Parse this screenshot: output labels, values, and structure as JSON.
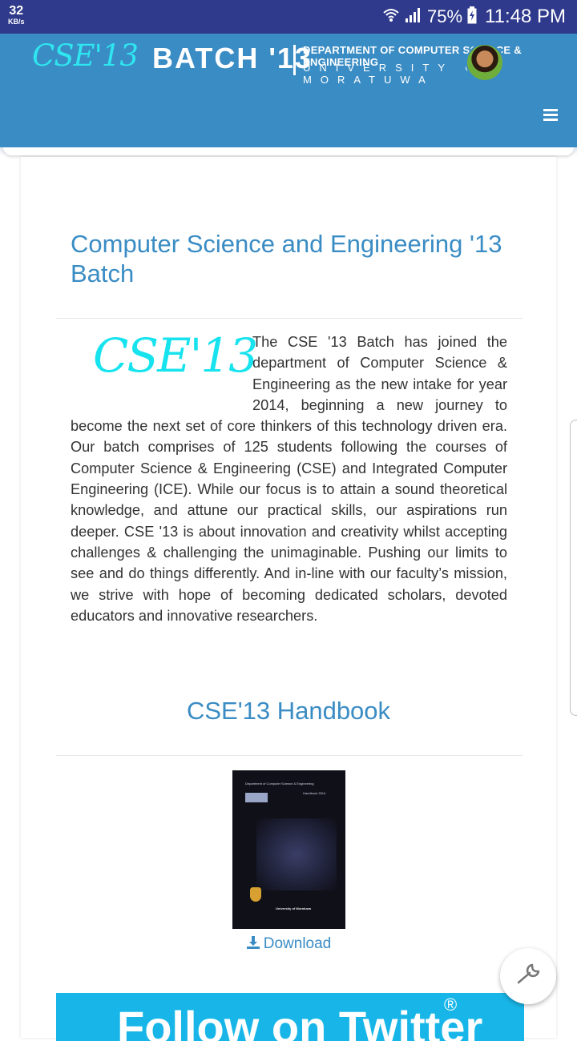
{
  "status_bar": {
    "speed_value": "32",
    "speed_unit": "KB/s",
    "battery_percent": "75%",
    "time": "11:48 PM"
  },
  "header": {
    "logo_text": "CSE'13",
    "batch_title": "BATCH '13",
    "department": "DEPARTMENT OF COMPUTER SCIENCE & ENGINEERING",
    "university": "UNIVERSITY OF MORATUWA",
    "menu_icon": "hamburger-menu-icon",
    "accent_color": "#3a8cc4"
  },
  "main": {
    "title": "Computer Science and Engineering '13 Batch",
    "logo_text": "CSE'13",
    "paragraph": "The CSE '13 Batch has joined the department of Computer Science & Engineering as the new intake for year 2014, beginning a new journey to become the next set of core thinkers of this technology driven era. Our batch comprises of 125 students following the courses of Computer Science & Engineering (CSE) and Integrated Computer Engineering (ICE). While our focus is to attain a sound theoretical knowledge, and attune our practical skills, our aspirations run deeper. CSE '13 is about innovation and creativity whilst accepting challenges & challenging the unimaginable. Pushing our limits to see and do things differently. And in-line with our faculty’s mission, we strive with hope of becoming dedicated scholars, devoted educators and innovative researchers.",
    "handbook_title": "CSE'13 Handbook",
    "handbook_cover": {
      "top_text": "Department of Computer Science & Engineering",
      "edition": "Handbook 2014",
      "bottom_text": "University of Moratuwa"
    },
    "download_label": "Download",
    "twitter_label": "Follow on Twitter",
    "twitter_mark": "®"
  }
}
